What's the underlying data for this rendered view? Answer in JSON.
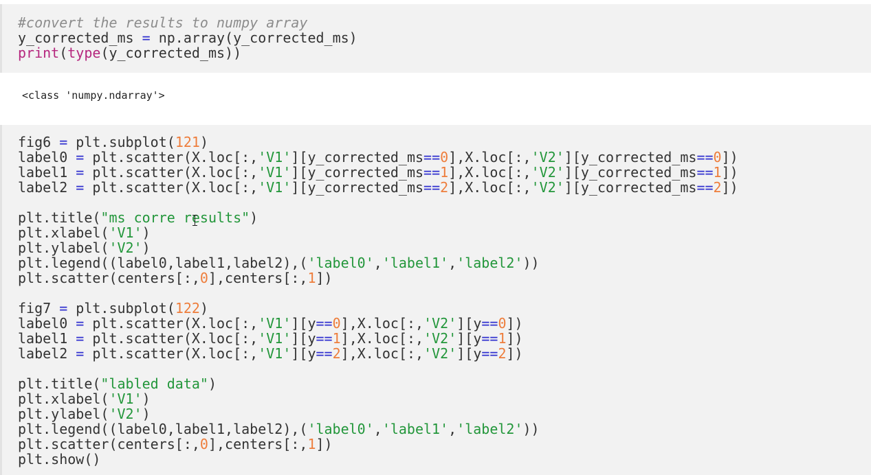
{
  "cells": [
    {
      "lines": [
        [
          {
            "t": "comment",
            "v": "#convert the results to numpy array"
          }
        ],
        [
          {
            "t": "text",
            "v": "y_corrected_ms "
          },
          {
            "t": "op",
            "v": "="
          },
          {
            "t": "text",
            "v": " np.array(y_corrected_ms)"
          }
        ],
        [
          {
            "t": "builtin",
            "v": "print"
          },
          {
            "t": "text",
            "v": "("
          },
          {
            "t": "builtin",
            "v": "type"
          },
          {
            "t": "text",
            "v": "(y_corrected_ms))"
          }
        ]
      ]
    },
    {
      "lines": [
        [
          {
            "t": "text",
            "v": "fig6 "
          },
          {
            "t": "op",
            "v": "="
          },
          {
            "t": "text",
            "v": " plt.subplot("
          },
          {
            "t": "num",
            "v": "121"
          },
          {
            "t": "text",
            "v": ")"
          }
        ],
        [
          {
            "t": "text",
            "v": "label0 "
          },
          {
            "t": "op",
            "v": "="
          },
          {
            "t": "text",
            "v": " plt.scatter(X.loc[:,"
          },
          {
            "t": "str",
            "v": "'V1'"
          },
          {
            "t": "text",
            "v": "][y_corrected_ms"
          },
          {
            "t": "op",
            "v": "=="
          },
          {
            "t": "num",
            "v": "0"
          },
          {
            "t": "text",
            "v": "],X.loc[:,"
          },
          {
            "t": "str",
            "v": "'V2'"
          },
          {
            "t": "text",
            "v": "][y_corrected_ms"
          },
          {
            "t": "op",
            "v": "=="
          },
          {
            "t": "num",
            "v": "0"
          },
          {
            "t": "text",
            "v": "])"
          }
        ],
        [
          {
            "t": "text",
            "v": "label1 "
          },
          {
            "t": "op",
            "v": "="
          },
          {
            "t": "text",
            "v": " plt.scatter(X.loc[:,"
          },
          {
            "t": "str",
            "v": "'V1'"
          },
          {
            "t": "text",
            "v": "][y_corrected_ms"
          },
          {
            "t": "op",
            "v": "=="
          },
          {
            "t": "num",
            "v": "1"
          },
          {
            "t": "text",
            "v": "],X.loc[:,"
          },
          {
            "t": "str",
            "v": "'V2'"
          },
          {
            "t": "text",
            "v": "][y_corrected_ms"
          },
          {
            "t": "op",
            "v": "=="
          },
          {
            "t": "num",
            "v": "1"
          },
          {
            "t": "text",
            "v": "])"
          }
        ],
        [
          {
            "t": "text",
            "v": "label2 "
          },
          {
            "t": "op",
            "v": "="
          },
          {
            "t": "text",
            "v": " plt.scatter(X.loc[:,"
          },
          {
            "t": "str",
            "v": "'V1'"
          },
          {
            "t": "text",
            "v": "][y_corrected_ms"
          },
          {
            "t": "op",
            "v": "=="
          },
          {
            "t": "num",
            "v": "2"
          },
          {
            "t": "text",
            "v": "],X.loc[:,"
          },
          {
            "t": "str",
            "v": "'V2'"
          },
          {
            "t": "text",
            "v": "][y_corrected_ms"
          },
          {
            "t": "op",
            "v": "=="
          },
          {
            "t": "num",
            "v": "2"
          },
          {
            "t": "text",
            "v": "])"
          }
        ],
        [],
        [
          {
            "t": "text",
            "v": "plt.title("
          },
          {
            "t": "str",
            "v": "\"ms corre results\""
          },
          {
            "t": "text",
            "v": ")"
          }
        ],
        [
          {
            "t": "text",
            "v": "plt.xlabel("
          },
          {
            "t": "str",
            "v": "'V1'"
          },
          {
            "t": "text",
            "v": ")"
          }
        ],
        [
          {
            "t": "text",
            "v": "plt.ylabel("
          },
          {
            "t": "str",
            "v": "'V2'"
          },
          {
            "t": "text",
            "v": ")"
          }
        ],
        [
          {
            "t": "text",
            "v": "plt.legend((label0,label1,label2),("
          },
          {
            "t": "str",
            "v": "'label0'"
          },
          {
            "t": "text",
            "v": ","
          },
          {
            "t": "str",
            "v": "'label1'"
          },
          {
            "t": "text",
            "v": ","
          },
          {
            "t": "str",
            "v": "'label2'"
          },
          {
            "t": "text",
            "v": "))"
          }
        ],
        [
          {
            "t": "text",
            "v": "plt.scatter(centers[:,"
          },
          {
            "t": "num",
            "v": "0"
          },
          {
            "t": "text",
            "v": "],centers[:,"
          },
          {
            "t": "num",
            "v": "1"
          },
          {
            "t": "text",
            "v": "])"
          }
        ],
        [],
        [
          {
            "t": "text",
            "v": "fig7 "
          },
          {
            "t": "op",
            "v": "="
          },
          {
            "t": "text",
            "v": " plt.subplot("
          },
          {
            "t": "num",
            "v": "122"
          },
          {
            "t": "text",
            "v": ")"
          }
        ],
        [
          {
            "t": "text",
            "v": "label0 "
          },
          {
            "t": "op",
            "v": "="
          },
          {
            "t": "text",
            "v": " plt.scatter(X.loc[:,"
          },
          {
            "t": "str",
            "v": "'V1'"
          },
          {
            "t": "text",
            "v": "][y"
          },
          {
            "t": "op",
            "v": "=="
          },
          {
            "t": "num",
            "v": "0"
          },
          {
            "t": "text",
            "v": "],X.loc[:,"
          },
          {
            "t": "str",
            "v": "'V2'"
          },
          {
            "t": "text",
            "v": "][y"
          },
          {
            "t": "op",
            "v": "=="
          },
          {
            "t": "num",
            "v": "0"
          },
          {
            "t": "text",
            "v": "])"
          }
        ],
        [
          {
            "t": "text",
            "v": "label1 "
          },
          {
            "t": "op",
            "v": "="
          },
          {
            "t": "text",
            "v": " plt.scatter(X.loc[:,"
          },
          {
            "t": "str",
            "v": "'V1'"
          },
          {
            "t": "text",
            "v": "][y"
          },
          {
            "t": "op",
            "v": "=="
          },
          {
            "t": "num",
            "v": "1"
          },
          {
            "t": "text",
            "v": "],X.loc[:,"
          },
          {
            "t": "str",
            "v": "'V2'"
          },
          {
            "t": "text",
            "v": "][y"
          },
          {
            "t": "op",
            "v": "=="
          },
          {
            "t": "num",
            "v": "1"
          },
          {
            "t": "text",
            "v": "])"
          }
        ],
        [
          {
            "t": "text",
            "v": "label2 "
          },
          {
            "t": "op",
            "v": "="
          },
          {
            "t": "text",
            "v": " plt.scatter(X.loc[:,"
          },
          {
            "t": "str",
            "v": "'V1'"
          },
          {
            "t": "text",
            "v": "][y"
          },
          {
            "t": "op",
            "v": "=="
          },
          {
            "t": "num",
            "v": "2"
          },
          {
            "t": "text",
            "v": "],X.loc[:,"
          },
          {
            "t": "str",
            "v": "'V2'"
          },
          {
            "t": "text",
            "v": "][y"
          },
          {
            "t": "op",
            "v": "=="
          },
          {
            "t": "num",
            "v": "2"
          },
          {
            "t": "text",
            "v": "])"
          }
        ],
        [],
        [
          {
            "t": "text",
            "v": "plt.title("
          },
          {
            "t": "str",
            "v": "\"labled data\""
          },
          {
            "t": "text",
            "v": ")"
          }
        ],
        [
          {
            "t": "text",
            "v": "plt.xlabel("
          },
          {
            "t": "str",
            "v": "'V1'"
          },
          {
            "t": "text",
            "v": ")"
          }
        ],
        [
          {
            "t": "text",
            "v": "plt.ylabel("
          },
          {
            "t": "str",
            "v": "'V2'"
          },
          {
            "t": "text",
            "v": ")"
          }
        ],
        [
          {
            "t": "text",
            "v": "plt.legend((label0,label1,label2),("
          },
          {
            "t": "str",
            "v": "'label0'"
          },
          {
            "t": "text",
            "v": ","
          },
          {
            "t": "str",
            "v": "'label1'"
          },
          {
            "t": "text",
            "v": ","
          },
          {
            "t": "str",
            "v": "'label2'"
          },
          {
            "t": "text",
            "v": "))"
          }
        ],
        [
          {
            "t": "text",
            "v": "plt.scatter(centers[:,"
          },
          {
            "t": "num",
            "v": "0"
          },
          {
            "t": "text",
            "v": "],centers[:,"
          },
          {
            "t": "num",
            "v": "1"
          },
          {
            "t": "text",
            "v": "])"
          }
        ],
        [
          {
            "t": "text",
            "v": "plt.show()"
          }
        ]
      ]
    }
  ],
  "outputs": {
    "cell1_output": "<class 'numpy.ndarray'>"
  },
  "colors": {
    "comment": "#8c8c8c",
    "operator": "#2f2fcf",
    "number": "#ee7d3b",
    "string": "#22963a",
    "builtin": "#b5277e",
    "cell_background": "#f2f2f2"
  }
}
